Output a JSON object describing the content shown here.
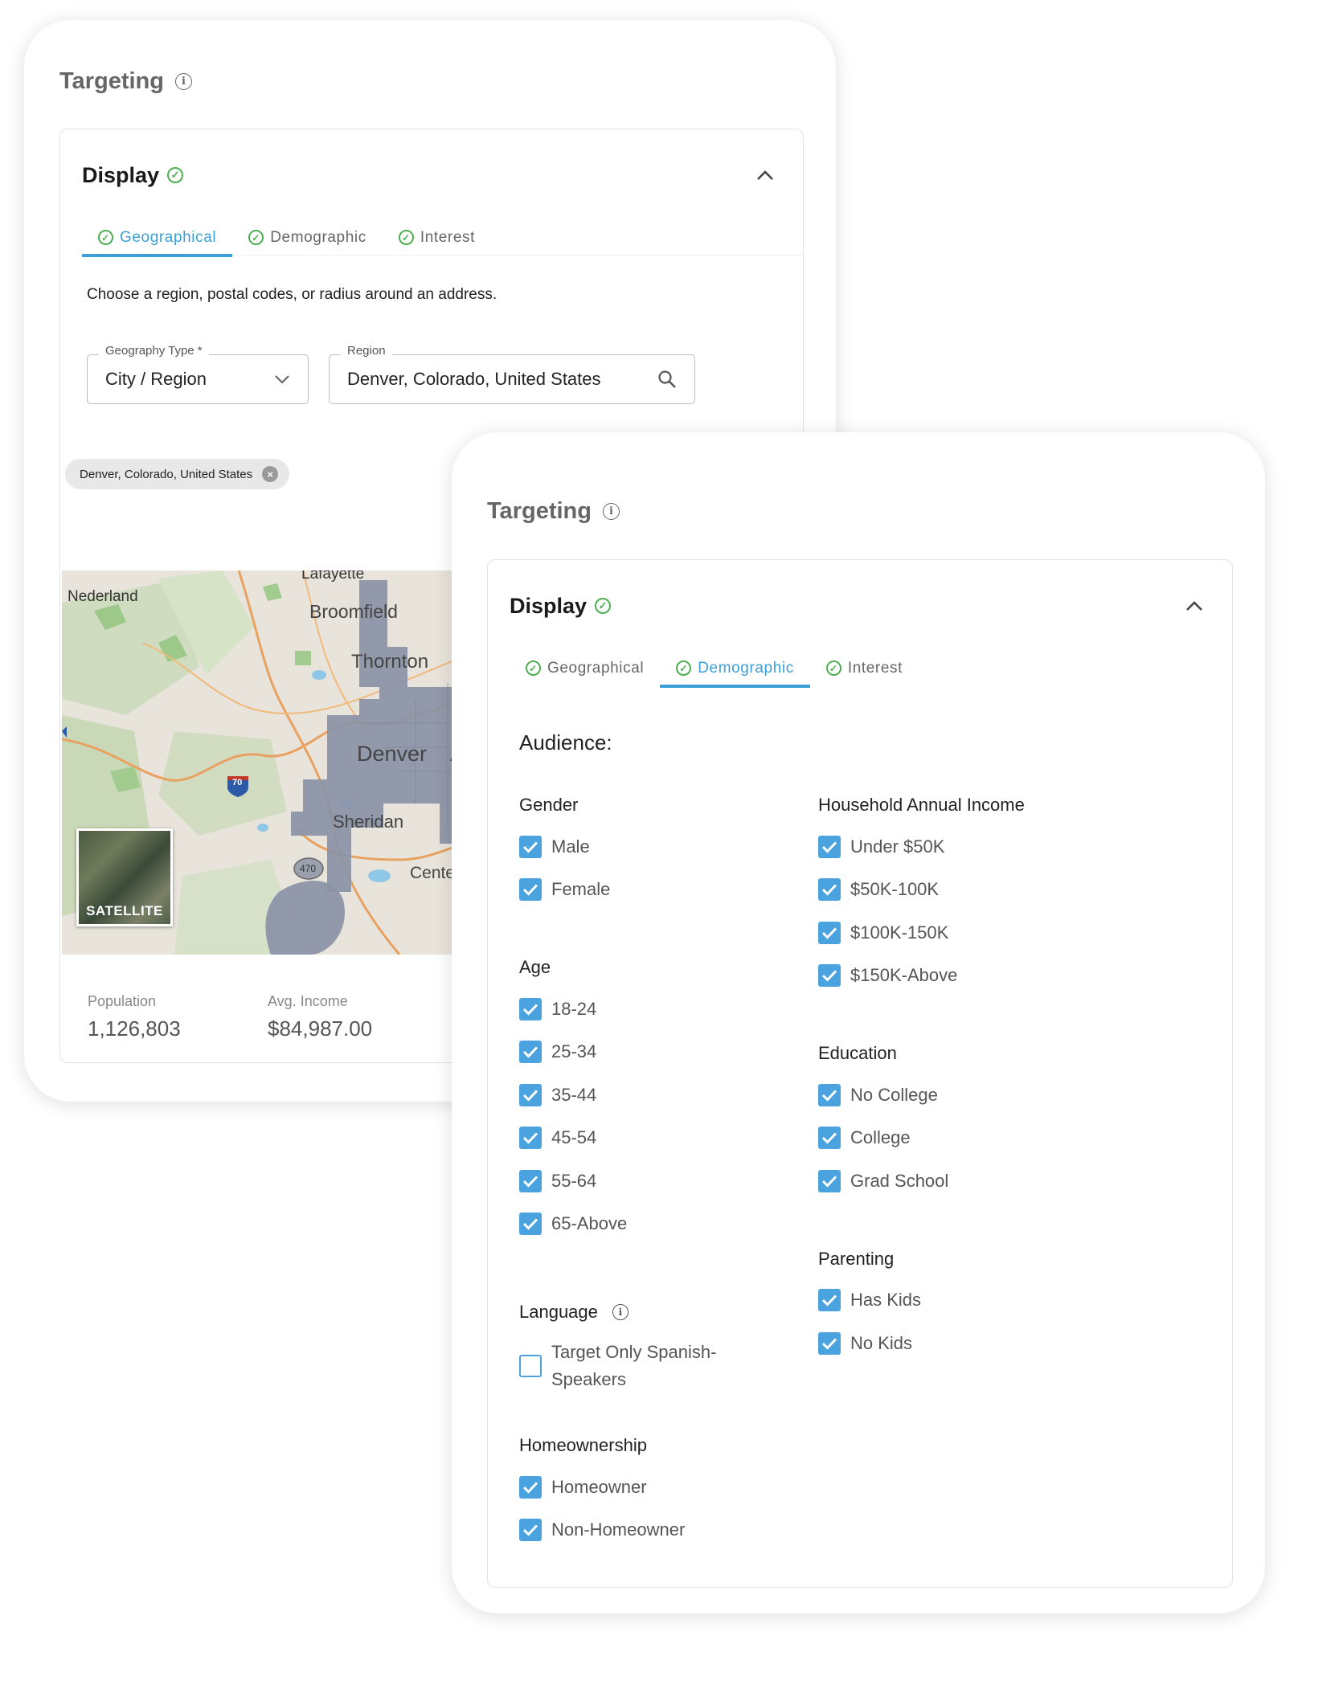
{
  "back": {
    "title": "Targeting",
    "display": {
      "title": "Display"
    },
    "tabs": [
      {
        "label": "Geographical"
      },
      {
        "label": "Demographic"
      },
      {
        "label": "Interest"
      }
    ],
    "description": "Choose a region, postal codes, or radius around an address.",
    "geography_type": {
      "label": "Geography Type *",
      "value": "City / Region"
    },
    "region": {
      "label": "Region",
      "value": "Denver, Colorado, United States"
    },
    "chip": "Denver, Colorado, United States",
    "map": {
      "labels": [
        "Lafayette",
        "Nederland",
        "Broomfield",
        "Thornton",
        "Denver",
        "A",
        "Sheridan",
        "Cente",
        "70",
        "470"
      ],
      "satellite": "SATELLITE"
    },
    "stats": {
      "population": {
        "label": "Population",
        "value": "1,126,803"
      },
      "income": {
        "label": "Avg. Income",
        "value": "$84,987.00"
      }
    }
  },
  "front": {
    "title": "Targeting",
    "display": {
      "title": "Display"
    },
    "tabs": [
      {
        "label": "Geographical"
      },
      {
        "label": "Demographic"
      },
      {
        "label": "Interest"
      }
    ],
    "audience": "Audience:",
    "gender": {
      "title": "Gender",
      "options": [
        "Male",
        "Female"
      ]
    },
    "age": {
      "title": "Age",
      "options": [
        "18-24",
        "25-34",
        "35-44",
        "45-54",
        "55-64",
        "65-Above"
      ]
    },
    "language": {
      "title": "Language",
      "option": "Target Only Spanish-Speakers"
    },
    "homeownership": {
      "title": "Homeownership",
      "options": [
        "Homeowner",
        "Non-Homeowner"
      ]
    },
    "income": {
      "title": "Household Annual Income",
      "options": [
        "Under $50K",
        "$50K-100K",
        "$100K-150K",
        "$150K-Above"
      ]
    },
    "education": {
      "title": "Education",
      "options": [
        "No College",
        "College",
        "Grad School"
      ]
    },
    "parenting": {
      "title": "Parenting",
      "options": [
        "Has Kids",
        "No Kids"
      ]
    }
  },
  "colors": {
    "accent": "#3aa0d6",
    "checkbox": "#4aa3df",
    "success": "#4caf50",
    "map_region": "#8a93a6"
  }
}
